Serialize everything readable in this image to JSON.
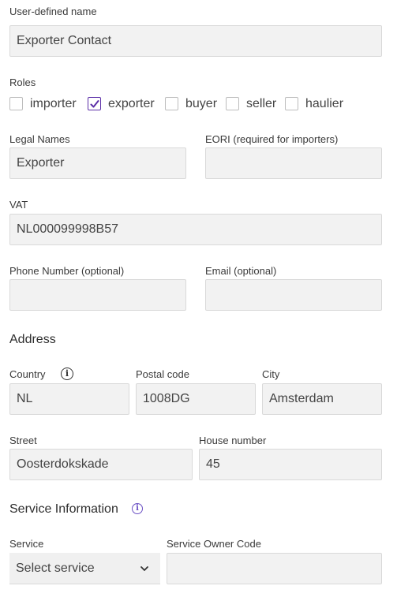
{
  "user_defined_name": {
    "label": "User-defined name",
    "value": "Exporter Contact"
  },
  "roles": {
    "label": "Roles",
    "items": [
      {
        "label": "importer",
        "checked": false
      },
      {
        "label": "exporter",
        "checked": true
      },
      {
        "label": "buyer",
        "checked": false
      },
      {
        "label": "seller",
        "checked": false
      },
      {
        "label": "haulier",
        "checked": false
      }
    ]
  },
  "legal_names": {
    "label": "Legal Names",
    "value": "Exporter"
  },
  "eori": {
    "label": "EORI (required for importers)",
    "value": ""
  },
  "vat": {
    "label": "VAT",
    "value": "NL000099998B57"
  },
  "phone": {
    "label": "Phone Number (optional)",
    "value": ""
  },
  "email": {
    "label": "Email (optional)",
    "value": ""
  },
  "address": {
    "title": "Address",
    "country": {
      "label": "Country",
      "value": "NL"
    },
    "postal_code": {
      "label": "Postal code",
      "value": "1008DG"
    },
    "city": {
      "label": "City",
      "value": "Amsterdam"
    },
    "street": {
      "label": "Street",
      "value": "Oosterdokskade"
    },
    "house_number": {
      "label": "House number",
      "value": "45"
    }
  },
  "service_information": {
    "title": "Service Information",
    "service": {
      "label": "Service",
      "selected": "Select service"
    },
    "owner_code": {
      "label": "Service Owner Code",
      "value": ""
    }
  },
  "colors": {
    "accent": "#5b2ea8",
    "info_icon": "#6a4fc4",
    "field_bg": "#f2f2f2"
  }
}
